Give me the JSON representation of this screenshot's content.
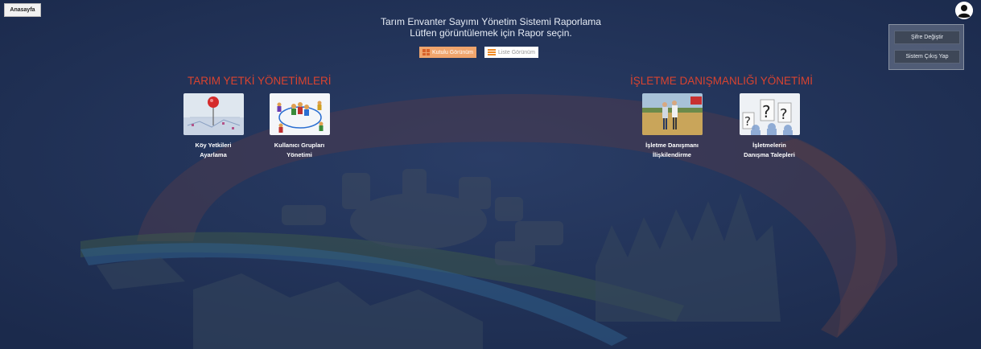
{
  "home": {
    "label": "Anasayfa"
  },
  "header": {
    "title": "Tarım Envanter Sayımı Yönetim Sistemi Raporlama",
    "subtitle": "Lütfen görüntülemek için Rapor seçin."
  },
  "view_toggle": {
    "grid_label": "Kutulu Görünüm",
    "list_label": "Liste Görünüm",
    "active": "grid"
  },
  "sections": [
    {
      "title": "TARIM YETKİ YÖNETİMLERİ",
      "tiles": [
        {
          "line1": "Köy Yetkileri",
          "line2": "Ayarlama",
          "icon": "map-pin-icon"
        },
        {
          "line1": "Kullanıcı Grupları",
          "line2": "Yönetimi",
          "icon": "user-network-icon"
        }
      ]
    },
    {
      "title": "İŞLETME DANIŞMANLIĞI YÖNETİMİ",
      "tiles": [
        {
          "line1": "İşletme Danışmanı",
          "line2": "İlişkilendirme",
          "icon": "field-advisors-icon"
        },
        {
          "line1": "İşletmelerin",
          "line2": "Danışma Talepleri",
          "icon": "question-marks-icon"
        }
      ]
    }
  ],
  "user_menu": {
    "change_password": "Şifre Değiştir",
    "logout": "Sistem Çıkış Yap"
  },
  "colors": {
    "background": "#1f3156",
    "section_title": "#d9432f",
    "active_toggle": "#f0a56d"
  }
}
